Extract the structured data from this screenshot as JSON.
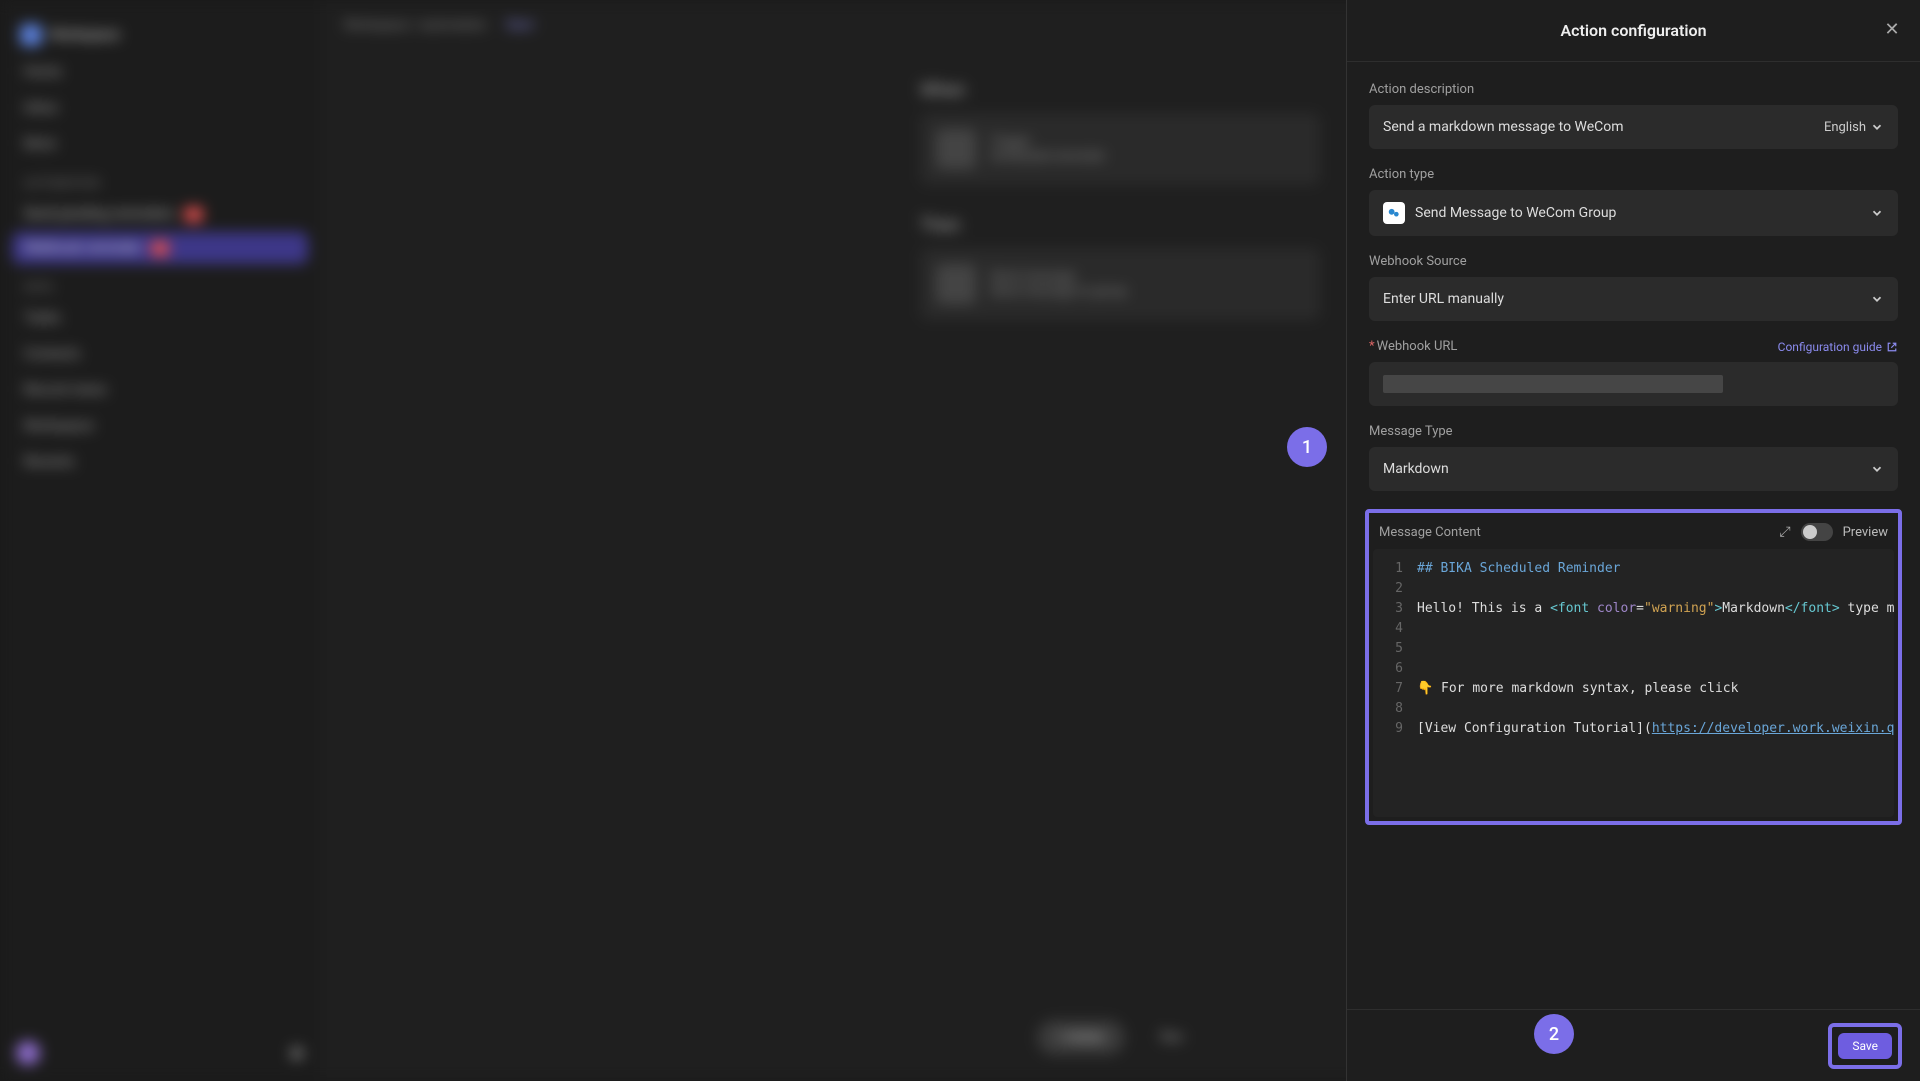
{
  "sidebar": {
    "workspace": "Workspace",
    "nav": [
      "Home",
      "Inbox",
      "More"
    ],
    "section_automation": "Automation",
    "automation_items": [
      {
        "label": "Send pending reminders",
        "badge": "3"
      },
      {
        "label": "Webhook reminder",
        "badge": "1"
      }
    ],
    "section_data": "Data",
    "data_items": [
      "Tasks",
      "Contacts",
      "Record views",
      "Workspace",
      "Recents"
    ]
  },
  "topbar": {
    "breadcrumb": "Workspace / automation",
    "start": "Start"
  },
  "cards": {
    "when": "When",
    "then": "Then",
    "card1_title": "Trigger",
    "card1_sub": "Scheduled reminder",
    "card2_title": "Send message",
    "card2_sub": "Send message to group"
  },
  "bottom": {
    "add_action": "+ Action",
    "run": "Run"
  },
  "panel": {
    "title": "Action configuration",
    "action_description_label": "Action description",
    "action_description_value": "Send a markdown message to WeCom",
    "language": "English",
    "action_type_label": "Action type",
    "action_type_value": "Send Message to WeCom Group",
    "webhook_source_label": "Webhook Source",
    "webhook_source_value": "Enter URL manually",
    "webhook_url_label": "Webhook URL",
    "config_guide": "Configuration guide",
    "message_type_label": "Message Type",
    "message_type_value": "Markdown",
    "message_content_label": "Message Content",
    "preview_label": "Preview",
    "save": "Save"
  },
  "editor_lines": {
    "l1": "## BIKA Scheduled Reminder",
    "l2": "",
    "l3_pre": "Hello! This is a ",
    "l3_tag_open": "<font",
    "l3_attr": " color",
    "l3_eq": "=",
    "l3_val": "\"warning\"",
    "l3_close1": ">",
    "l3_body": "Markdown",
    "l3_tag_close": "</font>",
    "l3_post": " type messag",
    "l4": "",
    "l5": "",
    "l6": "",
    "l7": "👇 For more markdown syntax, please click",
    "l8": "",
    "l9_pre": "[View Configuration Tutorial](",
    "l9_url": "https://developer.work.weixin.qq.co"
  },
  "callouts": {
    "one": "1",
    "two": "2"
  }
}
